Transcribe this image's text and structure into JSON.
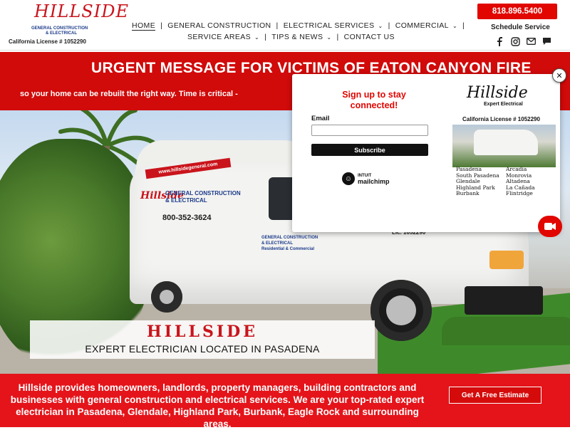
{
  "header": {
    "logo_text": "HILLSIDE",
    "logo_subtitle_1": "GENERAL CONSTRUCTION",
    "logo_subtitle_2": "& ELECTRICAL",
    "license": "California License # 1052290",
    "phone": "818.896.5400",
    "schedule": "Schedule Service",
    "social_icons": [
      "facebook-icon",
      "instagram-icon",
      "email-icon",
      "chat-icon"
    ]
  },
  "nav": {
    "row1": [
      {
        "label": "HOME",
        "active": true,
        "dropdown": false
      },
      {
        "label": "GENERAL CONSTRUCTION",
        "dropdown": false
      },
      {
        "label": "ELECTRICAL SERVICES",
        "dropdown": true
      },
      {
        "label": "COMMERCIAL",
        "dropdown": true
      }
    ],
    "row2": [
      {
        "label": "SERVICE AREAS",
        "dropdown": true
      },
      {
        "label": "TIPS & NEWS",
        "dropdown": true
      },
      {
        "label": "CONTACT US",
        "dropdown": false
      }
    ]
  },
  "banner": {
    "title": "URGENT MESSAGE FOR VICTIMS OF EATON CANYON FIRE",
    "subtitle": "so your home can be rebuilt the right way. Time is critical -"
  },
  "hero": {
    "van_url": "www.hillsidegeneral.com",
    "van_logo": "Hillside",
    "van_company_1": "GENERAL CONSTRUCTION",
    "van_company_2": "& ELECTRICAL",
    "van_phone": "800-352-3624",
    "van_side_1": "GENERAL CONSTRUCTION",
    "van_side_2": "& ELECTRICAL",
    "van_side_3": "Residential & Commercial",
    "van_license": "Lic. 1052290",
    "brand": "HILLSIDE",
    "tagline": "EXPERT ELECTRICIAN LOCATED IN PASADENA"
  },
  "popup": {
    "title": "Sign up to stay connected!",
    "email_label": "Email",
    "email_value": "",
    "subscribe": "Subscribe",
    "intuit": "INTUIT",
    "mailchimp": "mailchimp",
    "image": {
      "logo": "Hillside",
      "expert": "Expert Electrical",
      "license": "California License # 1052290",
      "cities_left": [
        "Pasadena",
        "South Pasadena",
        "Glendale",
        "Highland Park",
        "Burbank"
      ],
      "cities_right": [
        "Arcadia",
        "Monrovia",
        "Altadena",
        "La Cañada",
        "Flintridge"
      ]
    },
    "close": "✕"
  },
  "bottom": {
    "text": "Hillside provides homeowners, landlords, property managers, building contractors and businesses with general construction and electrical services. We are your top-rated expert electrician in Pasadena, Glendale, Highland Park, Burbank, Eagle Rock and surrounding areas.",
    "cta": "Get A Free Estimate"
  },
  "colors": {
    "brand_red": "#e10600",
    "banner_red": "#d10a0a",
    "navy": "#1a3a8a"
  }
}
